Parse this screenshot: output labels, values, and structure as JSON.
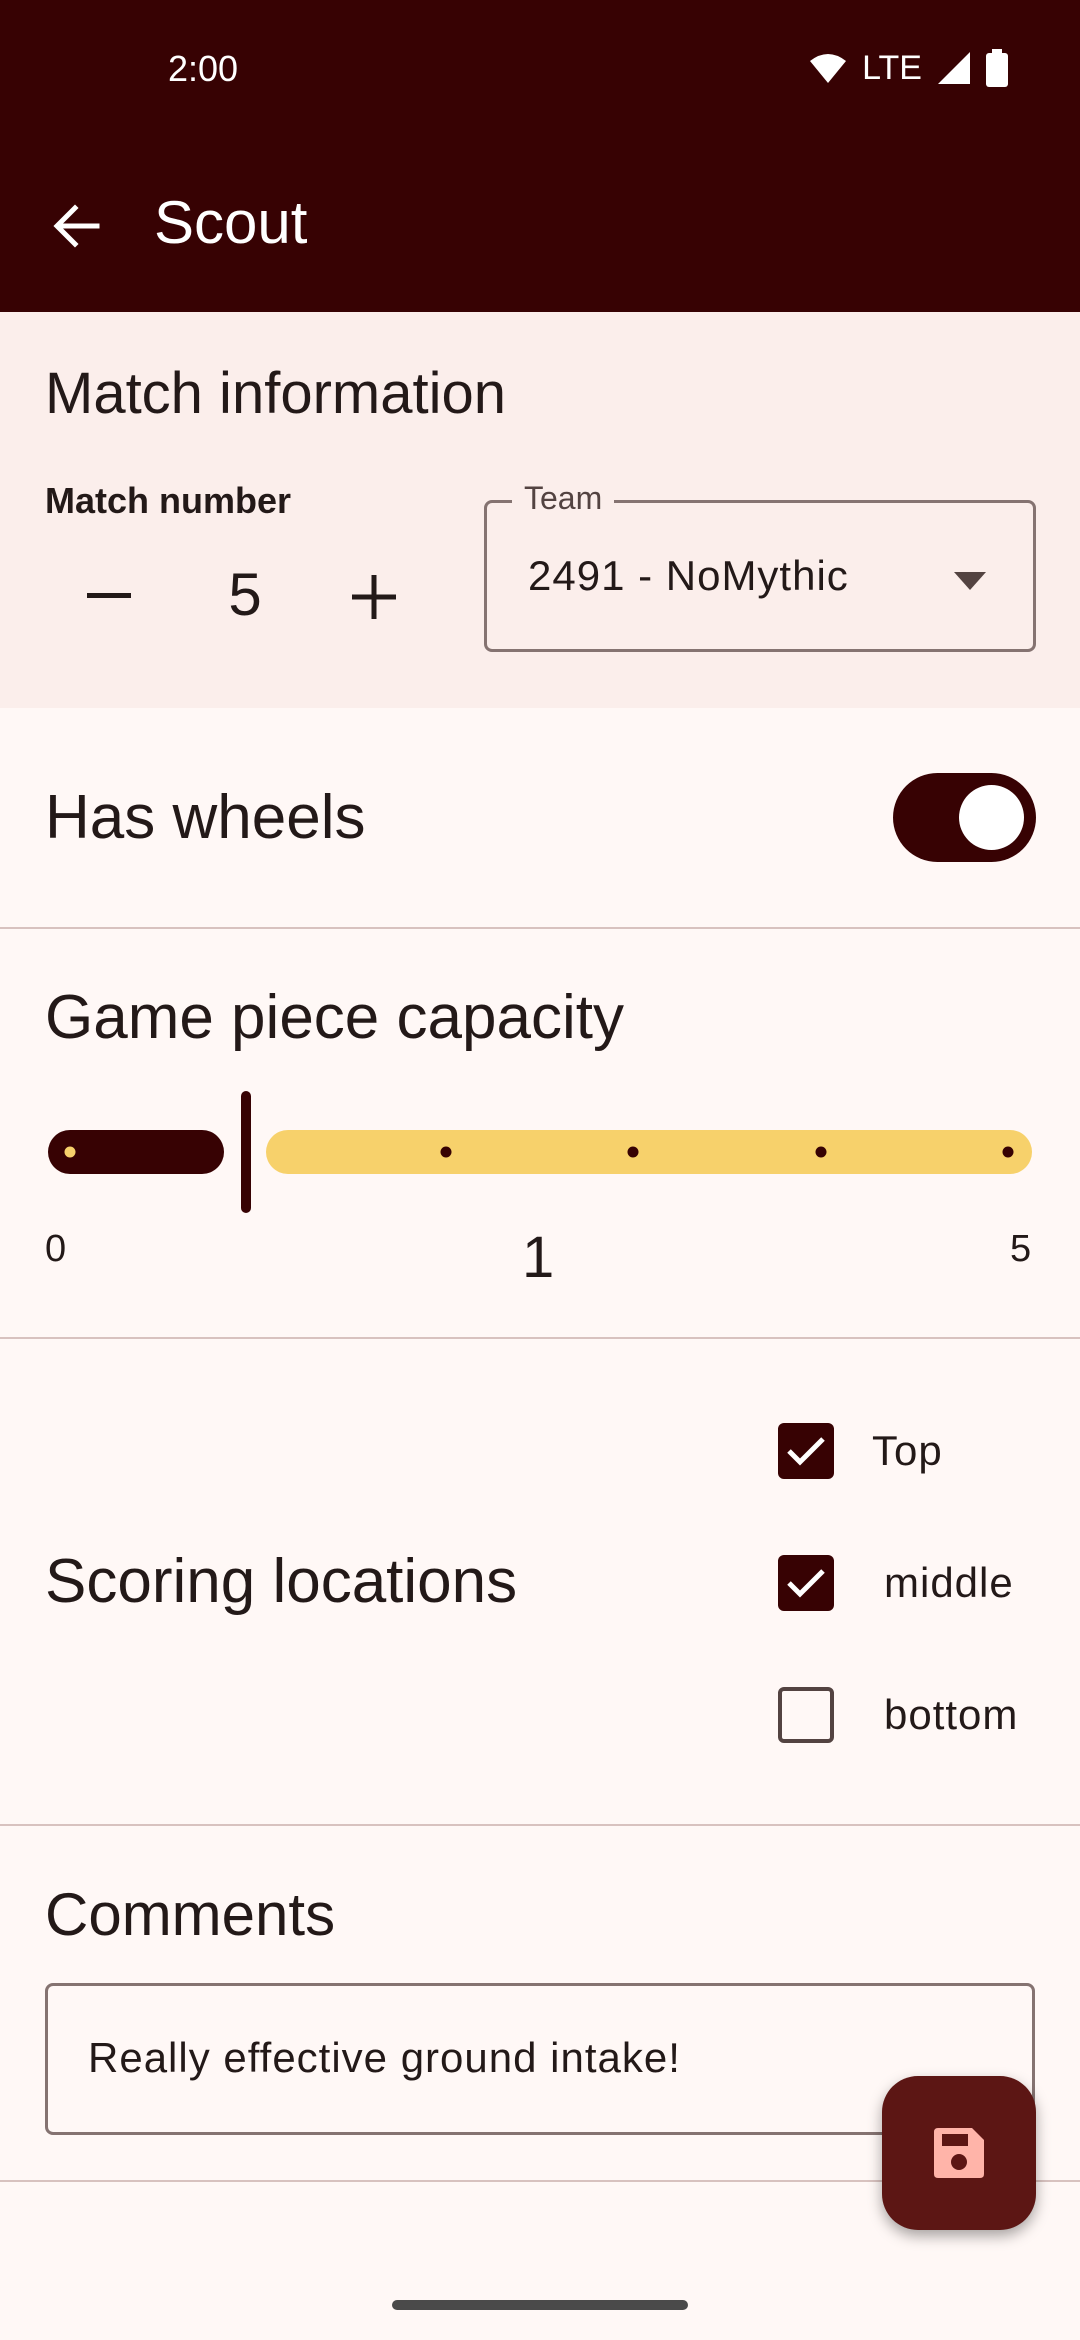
{
  "status_bar": {
    "time": "2:00",
    "network": "LTE"
  },
  "app_bar": {
    "title": "Scout",
    "back_icon": "arrow-back-icon"
  },
  "match": {
    "section_title": "Match information",
    "number_label": "Match number",
    "number_value": "5",
    "team_label": "Team",
    "team_value": "2491 - NoMythic"
  },
  "wheels": {
    "label": "Has wheels",
    "enabled": true
  },
  "capacity": {
    "label": "Game piece capacity",
    "min_label": "0",
    "value_label": "1",
    "max_label": "5",
    "value": 1,
    "min": 0,
    "max": 5
  },
  "scoring": {
    "label": "Scoring locations",
    "options": [
      {
        "label": "Top",
        "checked": true
      },
      {
        "label": "middle",
        "checked": true
      },
      {
        "label": "bottom",
        "checked": false
      }
    ]
  },
  "comments": {
    "label": "Comments",
    "value": "Really effective ground intake!"
  },
  "fab": {
    "icon": "save-icon"
  },
  "colors": {
    "primary": "#370203",
    "surface": "#fff8f6",
    "surface_container": "#fbeeeb",
    "slider_inactive": "#f7d16b",
    "fab": "#5c1614",
    "fab_icon": "#ffb4a9"
  }
}
